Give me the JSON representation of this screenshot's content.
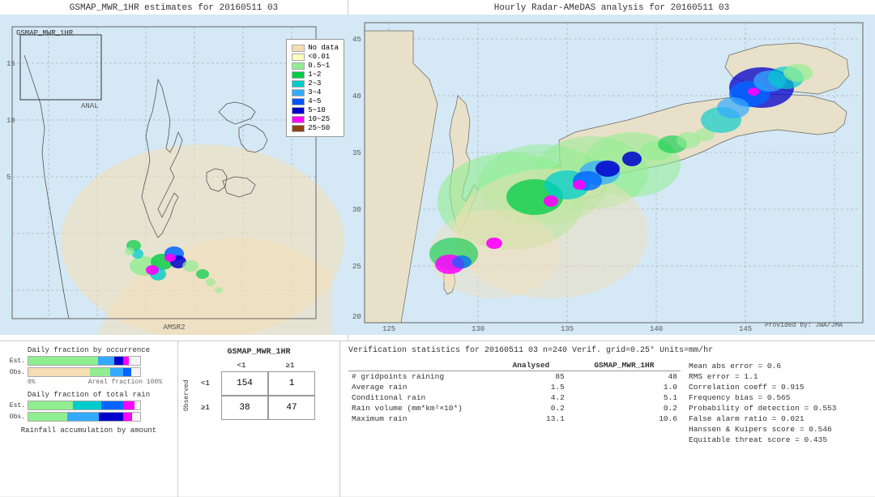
{
  "left_panel": {
    "title": "GSMAP_MWR_1HR estimates for 20160511 03",
    "label_gsmap": "GSMAP_MWR_1HR",
    "label_amsr2": "AMSR2",
    "label_anal": "ANAL",
    "lat_labels": [
      "15",
      "10",
      "5"
    ],
    "lon_labels": []
  },
  "right_panel": {
    "title": "Hourly Radar-AMeDAS analysis for 20160511 03",
    "label_provided": "Provided by: JWA/JMA",
    "lat_labels": [
      "45",
      "40",
      "35",
      "30",
      "25",
      "20"
    ],
    "lon_labels": [
      "125",
      "130",
      "135",
      "140",
      "145"
    ]
  },
  "legend": {
    "title": "No data",
    "items": [
      {
        "label": "No data",
        "color": "#f5deb3"
      },
      {
        "label": "<0.01",
        "color": "#ffffc0"
      },
      {
        "label": "0.5~1",
        "color": "#90ee90"
      },
      {
        "label": "1~2",
        "color": "#00cc44"
      },
      {
        "label": "2~3",
        "color": "#00cccc"
      },
      {
        "label": "3~4",
        "color": "#33aaff"
      },
      {
        "label": "4~5",
        "color": "#0055ff"
      },
      {
        "label": "5~10",
        "color": "#0000cc"
      },
      {
        "label": "10~25",
        "color": "#ff00ff"
      },
      {
        "label": "25~50",
        "color": "#8b4513"
      }
    ]
  },
  "bottom_charts": {
    "title1": "Daily fraction by occurrence",
    "title2": "Daily fraction of total rain",
    "title3": "Rainfall accumulation by amount",
    "est_label": "Est.",
    "obs_label": "Obs.",
    "axis_left": "0%",
    "axis_right": "Areal fraction 100%"
  },
  "contingency_table": {
    "title": "GSMAP_MWR_1HR",
    "col_lt1": "<1",
    "col_ge1": "≥1",
    "row_lt1": "<1",
    "row_ge1": "≥1",
    "observed_label": "O\nb\ns\ne\nr\nv\ne\nd",
    "val_lt1_lt1": "154",
    "val_lt1_ge1": "1",
    "val_ge1_lt1": "38",
    "val_ge1_ge1": "47"
  },
  "verification": {
    "title": "Verification statistics for 20160511 03  n=240  Verif. grid=0.25°  Units=mm/hr",
    "columns": [
      "Analysed",
      "GSMAP_MWR_1HR"
    ],
    "rows": [
      {
        "label": "# gridpoints raining",
        "analysed": "85",
        "gsmap": "48"
      },
      {
        "label": "Average rain",
        "analysed": "1.5",
        "gsmap": "1.0"
      },
      {
        "label": "Conditional rain",
        "analysed": "4.2",
        "gsmap": "5.1"
      },
      {
        "label": "Rain volume (mm*km²×10⁴)",
        "analysed": "0.2",
        "gsmap": "0.2"
      },
      {
        "label": "Maximum rain",
        "analysed": "13.1",
        "gsmap": "10.6"
      }
    ],
    "right_stats": [
      {
        "label": "Mean abs error = 0.6"
      },
      {
        "label": "RMS error = 1.1"
      },
      {
        "label": "Correlation coeff = 0.915"
      },
      {
        "label": "Frequency bias = 0.565"
      },
      {
        "label": "Probability of detection = 0.553"
      },
      {
        "label": "False alarm ratio = 0.021"
      },
      {
        "label": "Hanssen & Kuipers score = 0.546"
      },
      {
        "label": "Equitable threat score = 0.435"
      }
    ]
  }
}
